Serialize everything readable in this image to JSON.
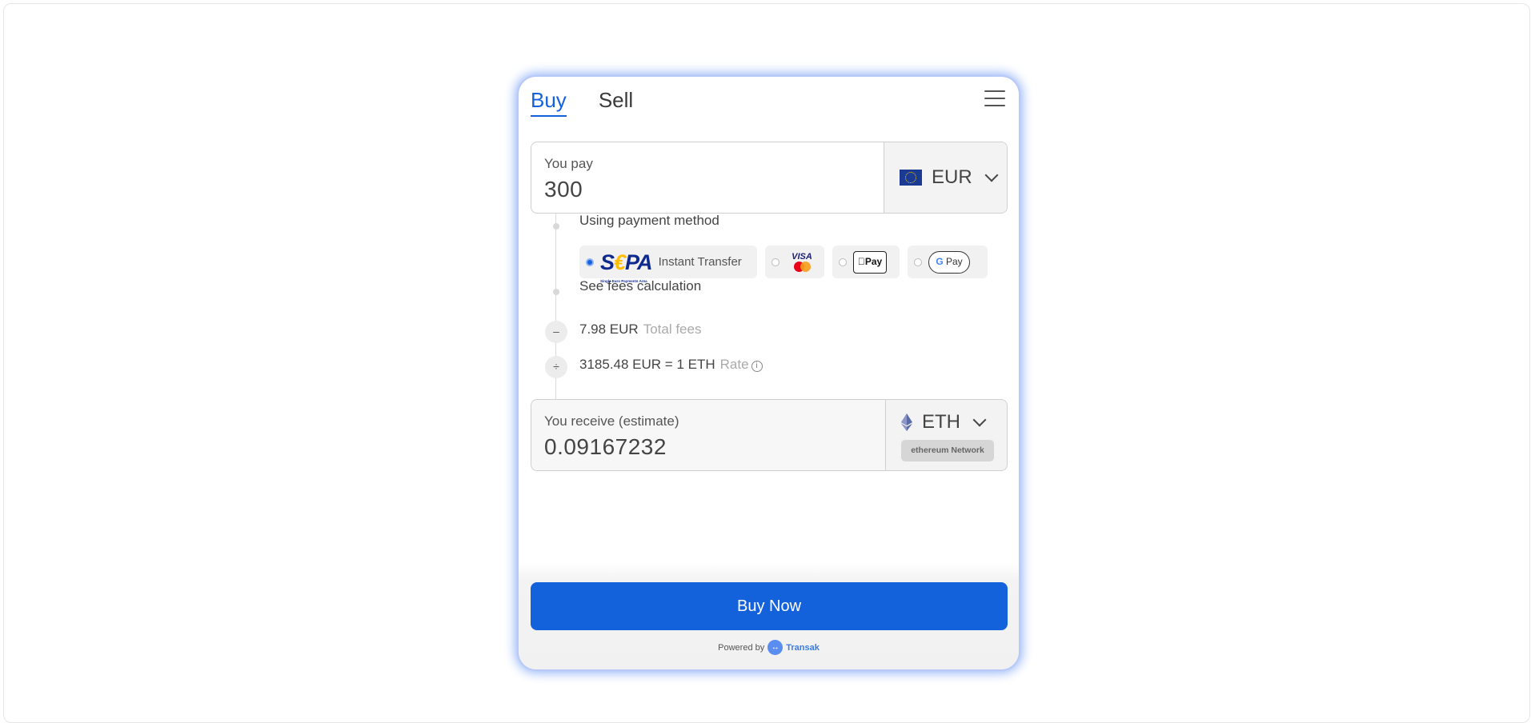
{
  "tabs": [
    {
      "label": "Buy",
      "active": true
    },
    {
      "label": "Sell",
      "active": false
    }
  ],
  "menu_icon": "hamburger-menu-icon",
  "pay": {
    "label": "You pay",
    "value": "300",
    "currency": "EUR",
    "currency_icon": "eu-flag-icon"
  },
  "timeline": {
    "payment_method_label": "Using payment method",
    "payment_methods": [
      {
        "name": "SEPA",
        "logo_text": "SEPA",
        "logo_subtext": "Single Euro Payments Area",
        "label": "Instant Transfer",
        "selected": true
      },
      {
        "name": "Visa / Mastercard",
        "logo_text": "VISA",
        "selected": false
      },
      {
        "name": "Apple Pay",
        "logo_text": "Pay",
        "selected": false
      },
      {
        "name": "Google Pay",
        "logo_text": "Pay",
        "selected": false
      }
    ],
    "see_fees": "See fees calculation",
    "fees_value": "7.98 EUR",
    "fees_label": "Total fees",
    "fees_operator": "–",
    "rate_value": "3185.48 EUR = 1 ETH",
    "rate_label": "Rate",
    "rate_operator": "÷"
  },
  "receive": {
    "label": "You receive (estimate)",
    "value": "0.09167232",
    "currency": "ETH",
    "currency_icon": "ethereum-icon",
    "network": "ethereum Network"
  },
  "buy_button": "Buy Now",
  "powered_by": {
    "prefix": "Powered by",
    "brand": "Transak"
  },
  "colors": {
    "accent": "#1461dc",
    "glow": "#8fb0f6"
  }
}
